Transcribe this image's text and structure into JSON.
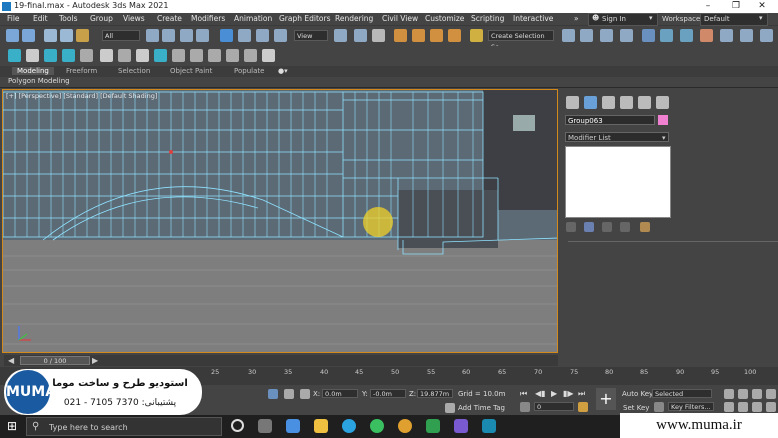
{
  "window": {
    "title": "19-final.max - Autodesk 3ds Max 2021"
  },
  "menu": [
    "File",
    "Edit",
    "Tools",
    "Group",
    "Views",
    "Create",
    "Modifiers",
    "Animation",
    "Graph Editors",
    "Rendering",
    "Civil View",
    "Customize",
    "Scripting",
    "Interactive"
  ],
  "menu_more": "»",
  "signin": {
    "label": "Sign In"
  },
  "workspaces": {
    "label": "Workspaces:",
    "value": "Default"
  },
  "toolbar": {
    "filter_value": "All",
    "view_value": "View",
    "selection_set": "Create Selection Se"
  },
  "ribbon": {
    "tabs": [
      "Modeling",
      "Freeform",
      "Selection",
      "Object Paint",
      "Populate"
    ],
    "active": "Modeling",
    "sub": "Polygon Modeling"
  },
  "viewport": {
    "label": "[+] [Perspective] [Standard] [Default Shading]"
  },
  "command_panel": {
    "object_name": "Group063",
    "object_color": "#f080d0",
    "modifier_list": "Modifier List"
  },
  "timeline": {
    "frame": "0 / 100",
    "ticks": [
      "25",
      "30",
      "35",
      "40",
      "45",
      "50",
      "55",
      "60",
      "65",
      "70",
      "75",
      "80",
      "85",
      "90",
      "95",
      "100"
    ]
  },
  "status": {
    "x_label": "X:",
    "x_value": "0.0m",
    "y_label": "Y:",
    "y_value": "-0.0m",
    "z_label": "Z:",
    "z_value": "19.877m",
    "grid": "Grid = 10.0m",
    "add_time_tag": "Add Time Tag",
    "auto_key": "Auto Key",
    "set_key": "Set Key",
    "selected": "Selected",
    "key_filters": "Key Filters...",
    "frame_value": "0"
  },
  "taskbar": {
    "search_placeholder": "Type here to search"
  },
  "brand": {
    "logo": "MUMA",
    "title": "استودیو طرح و ساخت موما",
    "phone": "پشتیبانی: 7370 7105 - 021"
  },
  "website": "www.muma.ir"
}
